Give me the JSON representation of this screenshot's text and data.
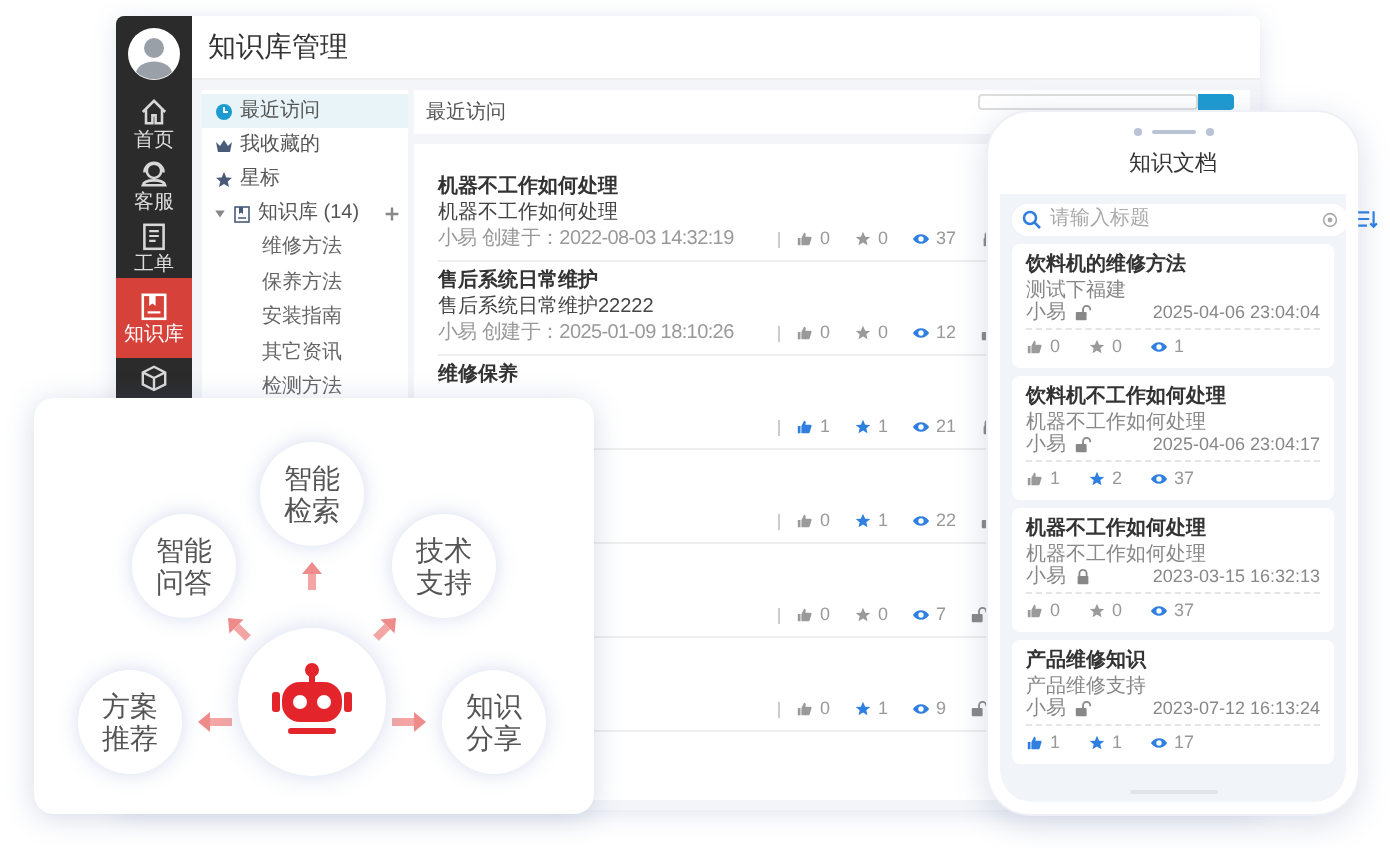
{
  "app": {
    "title": "知识库管理",
    "sidebar": [
      {
        "kind": "home",
        "label": "首页",
        "selected": false
      },
      {
        "kind": "headset",
        "label": "客服",
        "selected": false
      },
      {
        "kind": "clipboard",
        "label": "工单",
        "selected": false
      },
      {
        "kind": "book",
        "label": "知识库",
        "selected": true
      },
      {
        "kind": "box",
        "selected": false
      }
    ],
    "nav": [
      {
        "kind": "clock",
        "label": "最近访问",
        "selected": true
      },
      {
        "kind": "crown",
        "label": "我收藏的",
        "selected": false
      },
      {
        "kind": "star",
        "label": "星标",
        "selected": false
      },
      {
        "kind": "book",
        "label": "知识库 (14)",
        "selected": false,
        "expanded": true,
        "children": [
          {
            "label": "维修方法",
            "selected": false
          },
          {
            "label": "保养方法",
            "selected": false
          },
          {
            "label": "安装指南",
            "selected": false
          },
          {
            "label": "其它资讯",
            "selected": false
          },
          {
            "label": "检测方法",
            "selected": false
          }
        ]
      }
    ],
    "header": "最近访问",
    "rows": [
      {
        "title": "机器不工作如何处理",
        "desc": "机器不工作如何处理",
        "meta": "小易 创建于：2022-08-03 14:32:19",
        "locked": true,
        "counters": [
          {
            "kind": "like",
            "count": "0",
            "highlighted": false
          },
          {
            "kind": "star",
            "count": "0",
            "highlighted": false
          },
          {
            "kind": "eye",
            "count": "37",
            "highlighted": true
          }
        ]
      },
      {
        "title": "售后系统日常维护",
        "desc": "售后系统日常维护22222",
        "meta": "小易 创建于：2025-01-09 18:10:26",
        "locked": false,
        "counters": [
          {
            "kind": "like",
            "count": "0",
            "highlighted": false
          },
          {
            "kind": "star",
            "count": "0",
            "highlighted": false
          },
          {
            "kind": "eye",
            "count": "12",
            "highlighted": true
          }
        ]
      },
      {
        "title": "维修保养",
        "locked": true,
        "counters": [
          {
            "kind": "like",
            "count": "1",
            "highlighted": true
          },
          {
            "kind": "star",
            "count": "1",
            "highlighted": true
          },
          {
            "kind": "eye",
            "count": "21",
            "highlighted": true
          }
        ]
      },
      {
        "locked": false,
        "counters": [
          {
            "kind": "like",
            "count": "0",
            "highlighted": false
          },
          {
            "kind": "star",
            "count": "1",
            "highlighted": true
          },
          {
            "kind": "eye",
            "count": "22",
            "highlighted": true
          }
        ]
      },
      {
        "locked": false,
        "counters": [
          {
            "kind": "like",
            "count": "0",
            "highlighted": false
          },
          {
            "kind": "star",
            "count": "0",
            "highlighted": false
          },
          {
            "kind": "eye",
            "count": "7",
            "highlighted": true
          }
        ]
      },
      {
        "locked": false,
        "counters": [
          {
            "kind": "like",
            "count": "0",
            "highlighted": false
          },
          {
            "kind": "star",
            "count": "1",
            "highlighted": true
          },
          {
            "kind": "eye",
            "count": "9",
            "highlighted": true
          }
        ]
      }
    ]
  },
  "phone": {
    "title": "知识文档",
    "search": {
      "placeholder": "请输入标题"
    },
    "cards": [
      {
        "title": "饮料机的维修方法",
        "desc": "测试下福建",
        "author": "小易",
        "locked": false,
        "date": "2025-04-06 23:04:04",
        "counters": [
          {
            "kind": "like",
            "count": "0",
            "highlighted": false
          },
          {
            "kind": "star",
            "count": "0",
            "highlighted": false
          },
          {
            "kind": "eye",
            "count": "1",
            "highlighted": true
          }
        ]
      },
      {
        "title": "饮料机不工作如何处理",
        "desc": "机器不工作如何处理",
        "author": "小易",
        "locked": false,
        "date": "2025-04-06 23:04:17",
        "counters": [
          {
            "kind": "like",
            "count": "1",
            "highlighted": false
          },
          {
            "kind": "star",
            "count": "2",
            "highlighted": true
          },
          {
            "kind": "eye",
            "count": "37",
            "highlighted": true
          }
        ]
      },
      {
        "title": "机器不工作如何处理",
        "desc": "机器不工作如何处理",
        "author": "小易",
        "locked": true,
        "date": "2023-03-15 16:32:13",
        "counters": [
          {
            "kind": "like",
            "count": "0",
            "highlighted": false
          },
          {
            "kind": "star",
            "count": "0",
            "highlighted": false
          },
          {
            "kind": "eye",
            "count": "37",
            "highlighted": true
          }
        ]
      },
      {
        "title": "产品维修知识",
        "desc": "产品维修支持",
        "author": "小易",
        "locked": false,
        "date": "2023-07-12 16:13:24",
        "counters": [
          {
            "kind": "like",
            "count": "1",
            "highlighted": true
          },
          {
            "kind": "star",
            "count": "1",
            "highlighted": true
          },
          {
            "kind": "eye",
            "count": "17",
            "highlighted": true
          }
        ]
      }
    ]
  },
  "assistant": {
    "features": [
      {
        "label": "智能检索"
      },
      {
        "label": "智能问答"
      },
      {
        "label": "技术支持"
      },
      {
        "label": "方案推荐"
      },
      {
        "label": "知识分享"
      }
    ]
  }
}
